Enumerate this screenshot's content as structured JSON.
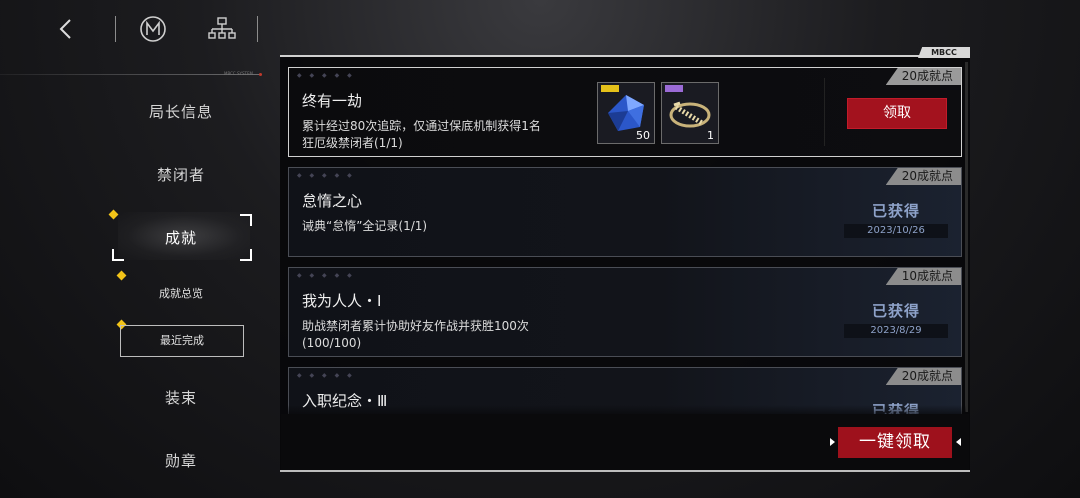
{
  "header": {
    "back_icon": "chevron-left-icon",
    "logo_icon": "mbcc-logo-icon",
    "tree_icon": "hierarchy-icon"
  },
  "nav": {
    "system_label": "MBCC SYSTEM",
    "items": [
      {
        "label": "局长信息"
      },
      {
        "label": "禁闭者"
      },
      {
        "label": "成就"
      },
      {
        "label": "装束"
      },
      {
        "label": "勋章"
      }
    ],
    "subitems": [
      {
        "label": "成就总览"
      },
      {
        "label": "最近完成"
      }
    ]
  },
  "panel": {
    "tag": "MBCC",
    "claim_all_label": "一键领取"
  },
  "achievements": [
    {
      "title": "终有一劫",
      "desc": "累计经过80次追踪，仅通过保底机制获得1名狂厄级禁闭者(1/1)",
      "points": "20成就点",
      "claim_label": "领取",
      "rewards": [
        {
          "icon": "blue-crystal-icon",
          "qty": "50"
        },
        {
          "icon": "gold-chain-icon",
          "qty": "1"
        }
      ]
    },
    {
      "title": "怠惰之心",
      "desc": "诫典“怠惰”全记录(1/1)",
      "points": "20成就点",
      "status": "已获得",
      "date": "2023/10/26"
    },
    {
      "title": "我为人人・Ⅰ",
      "desc": "助战禁闭者累计协助好友作战并获胜100次(100/100)",
      "points": "10成就点",
      "status": "已获得",
      "date": "2023/8/29"
    },
    {
      "title": "入职纪念・Ⅲ",
      "points": "20成就点",
      "status": "已获得"
    }
  ],
  "colors": {
    "accent_red": "#a3121e",
    "highlight_yellow": "#f2c318",
    "obtained_blue": "#8ea2c9"
  }
}
